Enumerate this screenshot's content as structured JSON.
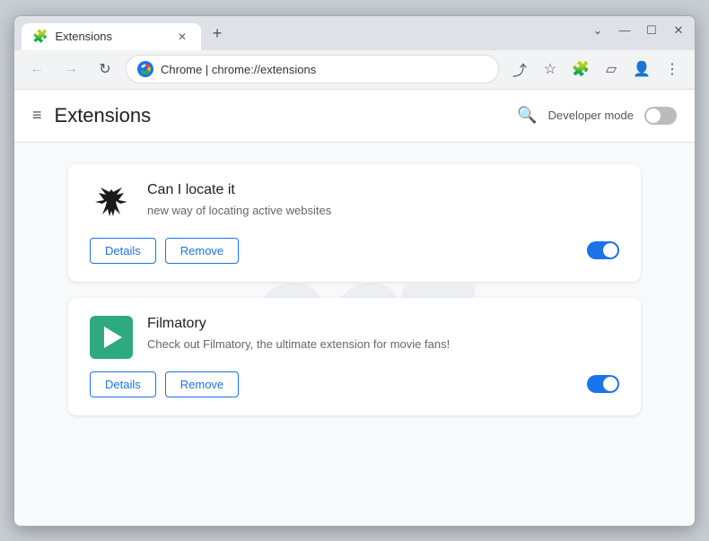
{
  "browser": {
    "tab_title": "Extensions",
    "tab_icon": "puzzle-icon",
    "new_tab_icon": "+",
    "window_controls": {
      "minimize": "—",
      "maximize": "☐",
      "close": "✕",
      "chevron": "⌄"
    },
    "nav": {
      "back_label": "←",
      "forward_label": "→",
      "reload_label": "↻"
    },
    "address_bar": {
      "brand": "Chrome",
      "url": "chrome://extensions"
    },
    "toolbar_icons": {
      "share": "⤴",
      "star": "☆",
      "extensions": "🧩",
      "split": "▱",
      "profile": "👤",
      "menu": "⋮"
    }
  },
  "page": {
    "title": "Extensions",
    "hamburger": "≡",
    "header_right": {
      "search_icon": "🔍",
      "developer_mode_label": "Developer mode"
    },
    "developer_mode_on": false
  },
  "extensions": [
    {
      "id": "can-i-locate-it",
      "name": "Can I locate it",
      "description": "new way of locating active websites",
      "enabled": true,
      "details_label": "Details",
      "remove_label": "Remove"
    },
    {
      "id": "filmatory",
      "name": "Filmatory",
      "description": "Check out Filmatory, the ultimate extension for movie fans!",
      "enabled": true,
      "details_label": "Details",
      "remove_label": "Remove"
    }
  ]
}
